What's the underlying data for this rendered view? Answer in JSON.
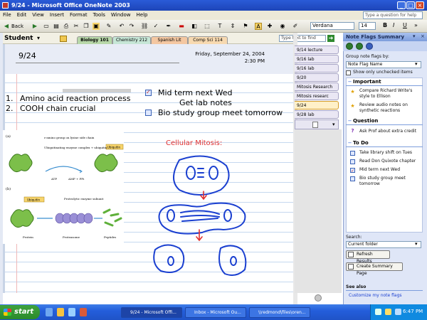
{
  "window": {
    "title": "9/24 - Microsoft Office OneNote 2003",
    "minimize": "_",
    "maximize": "□",
    "close": "×"
  },
  "menu": [
    "File",
    "Edit",
    "View",
    "Insert",
    "Format",
    "Tools",
    "Window",
    "Help"
  ],
  "help_placeholder": "Type a question for help",
  "toolbar": {
    "back_label": "Back",
    "font": "Verdana",
    "size": "14"
  },
  "notebook": "Student",
  "sections": [
    "Biology 101",
    "Chemistry 212",
    "Spanish Lit",
    "Comp Sci 114"
  ],
  "colors": {
    "biology": "#b7d7a8",
    "chemistry": "#c6e6d6",
    "spanish": "#f4c7a1",
    "compsci": "#f7d9b0"
  },
  "find_placeholder": "Type text to find",
  "page": {
    "title": "9/24",
    "date": "Friday, September 24, 2004",
    "time": "2:30 PM",
    "outline": [
      {
        "num": "1.",
        "text": "Amino acid reaction process"
      },
      {
        "num": "2.",
        "text": "COOH chain crucial"
      }
    ],
    "tagged": [
      {
        "text": "Mid term next Wed",
        "checked": true
      },
      {
        "text": "Get lab notes",
        "checked": false
      },
      {
        "text": "Bio study group meet tomorrow",
        "checked": false
      }
    ],
    "diagram_labels": {
      "a": "(a)",
      "b": "(b)",
      "amino": "ε-amino group on lysine side chain",
      "ligase": "Ubiquitinating enzyme complex + ubiquitin",
      "atp": "ATP",
      "amp": "AMP + PPi",
      "ubiquitin": "Ubiquitin",
      "protease": "Proteolytic enzyme subunit",
      "protein": "Protein",
      "proteasome": "Proteasome",
      "peptides": "Peptides"
    },
    "mitosis_title": "Cellular Mitosis:"
  },
  "page_tabs": [
    "9/14 lecture",
    "9/16 lab",
    "9/16 lab",
    "9/20",
    "Mitosis Research",
    "Mitosis researc",
    "9/24",
    "9/28 lab"
  ],
  "task_pane": {
    "title": "Note Flags Summary",
    "group_label": "Group note flags by:",
    "group_value": "Note Flag Name",
    "show_unchecked": "Show only unchecked items",
    "important_header": "Important",
    "important_items": [
      "Compare Richard Write's style to Ellison",
      "Review audio notes on synthetic reactions"
    ],
    "question_header": "Question",
    "question_items": [
      "Ask Prof about extra credit"
    ],
    "todo_header": "To Do",
    "todo_items": [
      "Take library shift on Tues",
      "Read Don Quixote chapter",
      "Mid term next Wed",
      "Bio study group meet tomorrow"
    ],
    "search_label": "Search:",
    "search_value": "Current folder",
    "refresh": "Refresh Results",
    "create": "Create Summary Page",
    "see_also": "See also",
    "customize": "Customize my note flags"
  },
  "taskbar": {
    "start": "start",
    "apps": [
      "9/24 - Microsoft Offi...",
      "Inbox - Microsoft Ou...",
      "\\\\redmond\\files\\oren..."
    ],
    "clock": "6:47 PM"
  }
}
